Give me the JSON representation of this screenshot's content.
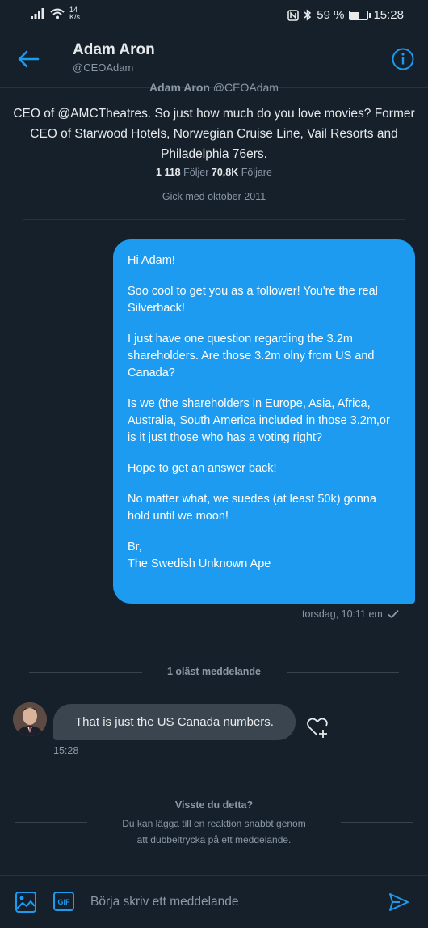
{
  "status_bar": {
    "net_speed_value": "14",
    "net_speed_unit": "K/s",
    "battery": "59 %",
    "battery_level": 0.59,
    "time": "15:28"
  },
  "header": {
    "name": "Adam Aron",
    "handle": "@CEOAdam"
  },
  "profile": {
    "cut_name": "Adam Aron",
    "cut_handle": "@CEOAdam",
    "bio": "CEO of @AMCTheatres. So just how much do you love movies? Former CEO of Starwood Hotels, Norwegian Cruise Line, Vail Resorts and Philadelphia 76ers.",
    "following_count": "1 118",
    "following_label": "Följer",
    "followers_count": "70,8K",
    "followers_label": "Följare",
    "joined": "Gick med oktober 2011"
  },
  "messages": {
    "outgoing": {
      "paragraphs": [
        "Hi Adam!",
        "Soo cool to get you as a follower! You're the real Silverback!",
        "I just have one question regarding the 3.2m shareholders. Are those 3.2m olny from US and Canada?",
        "Is we (the shareholders in Europe, Asia, Africa, Australia, South America included in those 3.2m,or is it just those who has a voting right?",
        "Hope to get an answer back!",
        "No matter what, we suedes (at least 50k) gonna hold until we moon!"
      ],
      "signoff_1": "Br,",
      "signoff_2": "The Swedish Unknown Ape",
      "timestamp": "torsdag, 10:11 em"
    },
    "unread_label": "1 oläst meddelande",
    "incoming": {
      "text": "That is just the US Canada numbers.",
      "time": "15:28"
    }
  },
  "tip": {
    "title": "Visste du detta?",
    "line1": "Du kan lägga till en reaktion snabbt genom",
    "line2": "att dubbeltrycka på ett meddelande."
  },
  "composer": {
    "placeholder": "Börja skriv ett meddelande",
    "gif_label": "GIF"
  },
  "colors": {
    "background": "#15202b",
    "accent": "#1d9bf0",
    "incoming_bubble": "#3a4550"
  }
}
